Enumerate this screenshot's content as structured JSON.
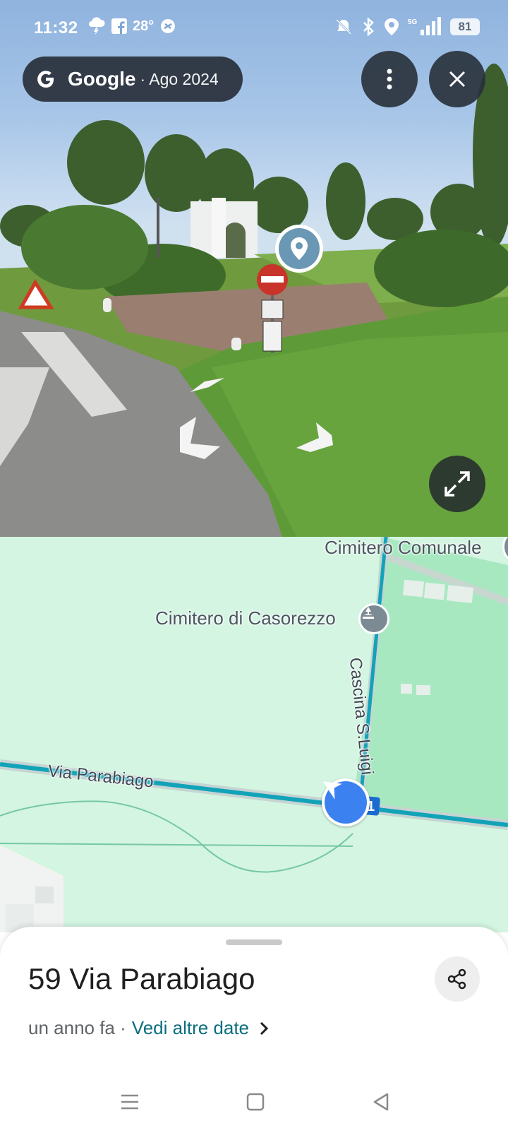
{
  "status_bar": {
    "time": "11:32",
    "temperature": "28°",
    "battery": "81",
    "icons_left": [
      "thunderstorm-icon",
      "facebook-icon",
      "sync-icon"
    ],
    "icons_right": [
      "bell-muted-icon",
      "bluetooth-icon",
      "location-icon",
      "5g-signal-icon"
    ]
  },
  "streetview": {
    "brand": "Google",
    "date": "· Ago 2024",
    "colors": {
      "overlay": "#283039",
      "pin": "#6a97b4"
    }
  },
  "map": {
    "labels": {
      "cemetery_comunale": "Cimitero Comunale",
      "cemetery_casorezzo": "Cimitero di Casorezzo",
      "road_cascina": "Cascina S.Luigi",
      "road_parabiago": "Via Parabiago",
      "route_badge": "1"
    },
    "colors": {
      "background": "#d3f5e1",
      "park": "#a8e8c0",
      "road": "#12a3b8",
      "position": "#3b82f0"
    }
  },
  "sheet": {
    "title": "59 Via Parabiago",
    "subtitle": "un anno fa ·",
    "link": "Vedi altre date",
    "link_color": "#0b6e7d"
  }
}
